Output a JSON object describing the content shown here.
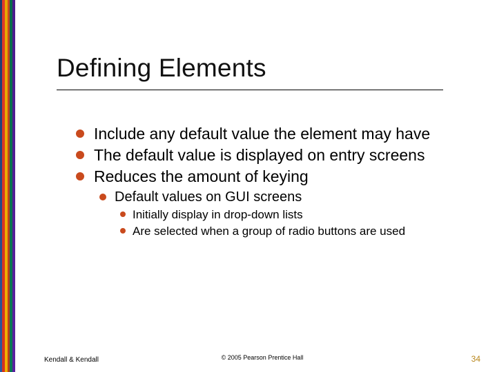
{
  "title": "Defining Elements",
  "bullets": {
    "lvl1": [
      "Include any default value the element may have",
      "The default value is displayed on entry screens",
      "Reduces the amount of keying"
    ],
    "lvl2": [
      "Default values on GUI screens"
    ],
    "lvl3": [
      "Initially display in drop-down lists",
      "Are selected when a group of radio buttons are used"
    ]
  },
  "footer": {
    "left": "Kendall & Kendall",
    "center": "© 2005 Pearson Prentice Hall",
    "page": "34"
  }
}
